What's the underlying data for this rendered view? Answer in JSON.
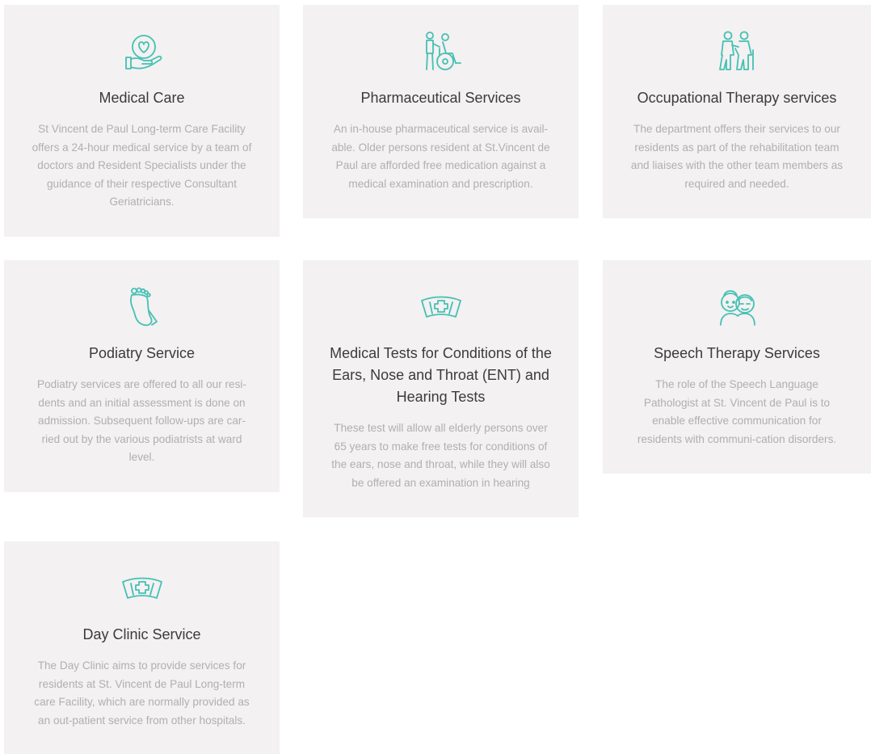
{
  "accent_color": "#45c0b4",
  "services": [
    {
      "icon": "heart-in-hand-icon",
      "title": "Medical Care",
      "description": "St Vincent de Paul Long-term Care Facility offers a 24-hour medical service by a team of doctors and Resident Specialists under the guidance of their respective Consultant Geriatricians."
    },
    {
      "icon": "wheelchair-assistance-icon",
      "title": "Pharmaceutical Services",
      "description": "An in-house pharmaceutical service is avail-able. Older persons resident at St.Vincent de Paul are afforded free medication against a medical examination and prescription."
    },
    {
      "icon": "elderly-walking-assistance-icon",
      "title": "Occupational Therapy services",
      "description": "The department offers their services to our residents as part of the rehabilitation team and liaises with the other team members as required and needed."
    },
    {
      "icon": "foot-icon",
      "title": "Podiatry Service",
      "description": "Podiatry services are offered to all our resi-dents and an initial assessment is done on admission. Subsequent follow-ups are car-ried out by the various podiatrists at ward level."
    },
    {
      "icon": "nurse-cap-icon",
      "title": "Medical Tests for Conditions of the Ears, Nose and Throat (ENT) and Hearing Tests",
      "description": "These test will allow all elderly persons over 65 years to make free tests for conditions of the ears, nose and throat, while they will also be offered an examination in hearing"
    },
    {
      "icon": "elderly-couple-icon",
      "title": "Speech Therapy Services",
      "description": "The role of the Speech Language Pathologist at St. Vincent de Paul is to enable effective communication for residents with communi-cation disorders."
    },
    {
      "icon": "nurse-cap-icon",
      "title": "Day Clinic Service",
      "description": "The Day Clinic aims to provide services for residents at St. Vincent de Paul Long-term care Facility, which are normally provided as an out-patient service from other hospitals."
    }
  ]
}
